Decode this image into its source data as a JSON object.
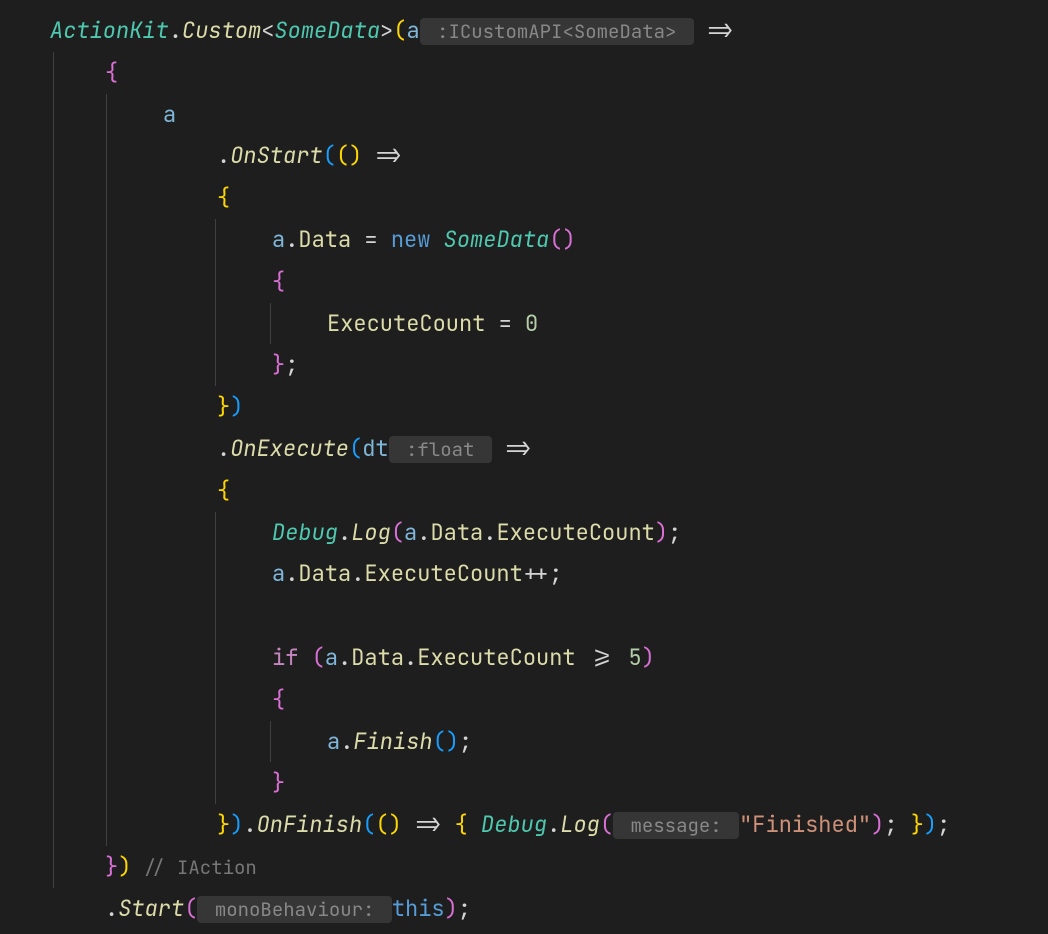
{
  "tokens": {
    "ActionKit": "ActionKit",
    "dot1": ".",
    "Custom": "Custom",
    "lt1": "<",
    "SomeData1": "SomeData",
    "gt1": ">",
    "lp1": "(",
    "a1": "a",
    "hint1": " :ICustomAPI<SomeData> ",
    "arrow1": " =>",
    "lbrace1": "{",
    "a2": "a",
    "dot2": ".",
    "OnStart": "OnStart",
    "lp2": "(",
    "lp3": "(",
    "rp3": ")",
    "arrow2": " =>",
    "lbrace2": "{",
    "a3": "a",
    "dot3": ".",
    "Data1": "Data",
    "eq1": " = ",
    "new1": "new",
    "sp1": " ",
    "SomeData2": "SomeData",
    "lp4": "(",
    "rp4": ")",
    "lbrace3": "{",
    "ExecuteCount1": "ExecuteCount",
    "eq2": " = ",
    "zero": "0",
    "rbrace3": "}",
    "semi1": ";",
    "rbrace2": "}",
    "rp2": ")",
    "dot4": ".",
    "OnExecute": "OnExecute",
    "lp5": "(",
    "dt": "dt",
    "hint2": " :float ",
    "arrow3": " =>",
    "lbrace4": "{",
    "Debug1": "Debug",
    "dot5": ".",
    "Log1": "Log",
    "lp6": "(",
    "a4": "a",
    "dot6": ".",
    "Data2": "Data",
    "dot7": ".",
    "ExecuteCount2": "ExecuteCount",
    "rp6": ")",
    "semi2": ";",
    "a5": "a",
    "dot8": ".",
    "Data3": "Data",
    "dot9": ".",
    "ExecuteCount3": "ExecuteCount",
    "inc": "++",
    "semi3": ";",
    "if1": "if",
    "sp2": " ",
    "lp7": "(",
    "a6": "a",
    "dot10": ".",
    "Data4": "Data",
    "dot11": ".",
    "ExecuteCount4": "ExecuteCount",
    "gte": " >= ",
    "five": "5",
    "rp7": ")",
    "lbrace5": "{",
    "a7": "a",
    "dot12": ".",
    "Finish": "Finish",
    "lp8": "(",
    "rp8": ")",
    "semi4": ";",
    "rbrace5": "}",
    "rbrace4": "}",
    "rp5": ")",
    "dot13": ".",
    "OnFinish": "OnFinish",
    "lp9": "(",
    "lp10": "(",
    "rp10": ")",
    "arrow4": " => ",
    "lbrace6": "{",
    "sp3": " ",
    "Debug2": "Debug",
    "dot14": ".",
    "Log2": "Log",
    "lp11": "(",
    "hint3": " message: ",
    "str1": "\"Finished\"",
    "rp11": ")",
    "semi5": ";",
    "sp4": " ",
    "rbrace6": "}",
    "rp9": ")",
    "semi6": ";",
    "rbrace1": "}",
    "rp1": ")",
    "comment1": " // IAction",
    "dot15": ".",
    "Start": "Start",
    "lp12": "(",
    "hint4": " monoBehaviour: ",
    "this1": "this",
    "rp12": ")",
    "semi7": ";"
  }
}
